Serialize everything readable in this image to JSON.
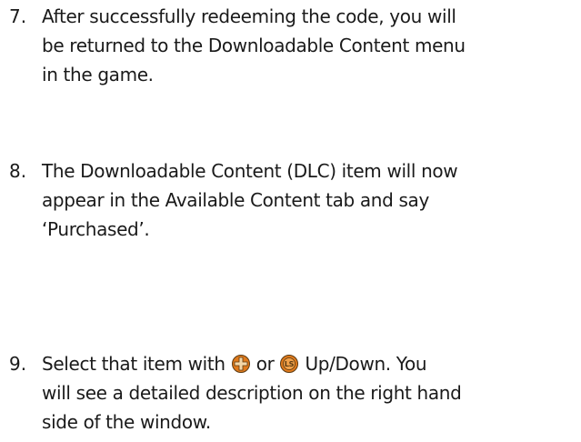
{
  "steps": [
    {
      "number": "7.",
      "lines": [
        "After successfully redeeming the code, you will",
        "be returned to the Downloadable Content menu",
        "in the game."
      ]
    },
    {
      "number": "8.",
      "lines": [
        "The Downloadable Content (DLC) item will now",
        "appear in the Available Content tab and say",
        "‘Purchased’."
      ]
    },
    {
      "number": "9.",
      "line1": {
        "before": "Select that item with",
        "between": "or",
        "after": "Up/Down.  You"
      },
      "lines_rest": [
        "will see a detailed description on the right hand",
        "side of the window."
      ],
      "icons": {
        "dpad": "dpad-icon",
        "left_stick": "left-stick-icon",
        "left_stick_label": "LS"
      }
    }
  ],
  "colors": {
    "text": "#1a1a1a",
    "icon_orange": "#e07a1c",
    "icon_dark": "#5a3a12"
  }
}
